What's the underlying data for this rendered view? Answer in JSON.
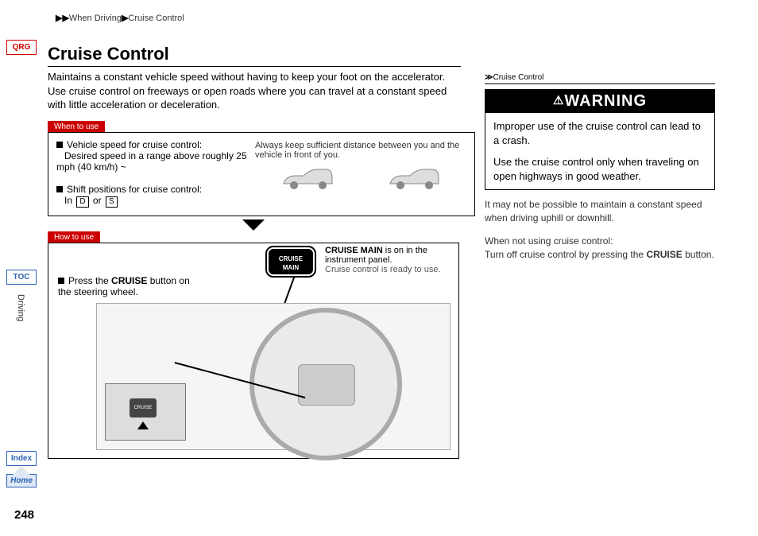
{
  "breadcrumb": {
    "section": "When Driving",
    "topic": "Cruise Control"
  },
  "sidebar": {
    "qrg": "QRG",
    "toc": "TOC",
    "rotate": "Driving",
    "index": "Index",
    "home": "Home"
  },
  "title": "Cruise Control",
  "intro": "Maintains a constant vehicle speed without having to keep your foot on the accelerator. Use cruise control on freeways or open roads where you can travel at a constant speed with little acceleration or deceleration.",
  "when_to_use": {
    "tag": "When to use",
    "speed_label": "Vehicle speed for cruise control:",
    "speed_detail": "Desired speed in a range above roughly 25 mph (40 km/h) ~",
    "shift_label": "Shift positions for cruise control:",
    "shift_prefix": "In ",
    "gear1": "D",
    "gear_or": " or ",
    "gear2": "S",
    "distance_note": "Always keep sufficient distance between you and the vehicle in front of you."
  },
  "how_to_use": {
    "tag": "How to use",
    "press_prefix": "Press the ",
    "press_bold": "CRUISE",
    "press_suffix": " button on the steering wheel.",
    "pill_line1": "CRUISE",
    "pill_line2": "MAIN",
    "main_bold": "CRUISE MAIN",
    "main_rest": " is on in the instrument panel.",
    "main_sub": "Cruise control is ready to use.",
    "inset_btn": "CRUISE"
  },
  "right": {
    "header": "Cruise Control",
    "warning_title": "WARNING",
    "warning_p1": "Improper use of the cruise control can lead to a crash.",
    "warning_p2": "Use the cruise control only when traveling on open highways in good weather.",
    "note1": "It may not be possible to maintain a constant speed when driving uphill or downhill.",
    "note2_line1": "When not using cruise control:",
    "note2_prefix": "Turn off cruise control by pressing the ",
    "note2_bold": "CRUISE",
    "note2_suffix": " button."
  },
  "page_number": "248"
}
